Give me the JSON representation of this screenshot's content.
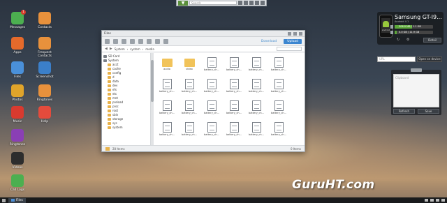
{
  "toolbar": {
    "search_placeholder": "Search"
  },
  "desktop_icons": [
    {
      "label": "Messages",
      "color": "#4caf50",
      "badge": "1"
    },
    {
      "label": "Contacts",
      "color": "#e8913c"
    },
    {
      "label": "Apps",
      "color": "#e56a2b"
    },
    {
      "label": "Frequent Contacts",
      "color": "#e8913c"
    },
    {
      "label": "Files",
      "color": "#4a90d9"
    },
    {
      "label": "Screenshot",
      "color": "#3b7fc9"
    },
    {
      "label": "Photos",
      "color": "#e0a42a"
    },
    {
      "label": "Ringtones",
      "color": "#e8913c"
    },
    {
      "label": "Music",
      "color": "#d83a2f"
    },
    {
      "label": "Help",
      "color": "#e44b3c"
    },
    {
      "label": "Ringtones",
      "color": "#8a3fb5"
    },
    {
      "label": "Videos",
      "color": "#2d2d2d"
    },
    {
      "label": "Call Logs",
      "color": "#4caf50"
    }
  ],
  "files_window": {
    "title": "Files",
    "download_label": "Download",
    "upload_label": "Upload",
    "path": [
      "System",
      "system",
      "media"
    ],
    "tree": [
      {
        "label": "SD Card",
        "root": true
      },
      {
        "label": "System",
        "root": true
      },
      {
        "label": "acct"
      },
      {
        "label": "cache"
      },
      {
        "label": "config"
      },
      {
        "label": "d"
      },
      {
        "label": "data"
      },
      {
        "label": "dev"
      },
      {
        "label": "efs"
      },
      {
        "label": "etc"
      },
      {
        "label": "mnt"
      },
      {
        "label": "preload"
      },
      {
        "label": "proc"
      },
      {
        "label": "root"
      },
      {
        "label": "sbin"
      },
      {
        "label": "storage"
      },
      {
        "label": "sys"
      },
      {
        "label": "system"
      }
    ],
    "items": [
      {
        "name": "audio",
        "type": "folder"
      },
      {
        "name": "video",
        "type": "folder"
      },
      {
        "name": "battery_ch...",
        "type": "file"
      },
      {
        "name": "battery_ch...",
        "type": "file"
      },
      {
        "name": "battery_ch...",
        "type": "file"
      },
      {
        "name": "battery_ch...",
        "type": "file"
      },
      {
        "name": "battery_ch...",
        "type": "file"
      },
      {
        "name": "battery_ch...",
        "type": "file"
      },
      {
        "name": "battery_ch...",
        "type": "file"
      },
      {
        "name": "battery_ch...",
        "type": "file"
      },
      {
        "name": "battery_ch...",
        "type": "file"
      },
      {
        "name": "battery_ch...",
        "type": "file"
      },
      {
        "name": "battery_ch...",
        "type": "file"
      },
      {
        "name": "battery_ch...",
        "type": "file"
      },
      {
        "name": "battery_ch...",
        "type": "file"
      },
      {
        "name": "battery_ch...",
        "type": "file"
      },
      {
        "name": "battery_ch...",
        "type": "file"
      },
      {
        "name": "battery_ch...",
        "type": "file"
      },
      {
        "name": "battery_ch...",
        "type": "file"
      },
      {
        "name": "battery_ch...",
        "type": "file"
      },
      {
        "name": "battery_ch...",
        "type": "file"
      },
      {
        "name": "battery_ch...",
        "type": "file"
      },
      {
        "name": "battery_ch...",
        "type": "file"
      },
      {
        "name": "battery_ch...",
        "type": "file"
      }
    ],
    "status": "28 Items",
    "selection": "0 Items"
  },
  "device": {
    "name": "Samsung GT-I9...",
    "model": "Android 4.1",
    "storage_1": "506.0 MB / 1.1 GB",
    "storage_1_fill": 0.45,
    "storage_2": "0.0 GB / 11.9 GB",
    "storage_2_fill": 0.05,
    "detail_label": "Detail"
  },
  "url_box": {
    "placeholder": "URL",
    "button": "Open on device"
  },
  "clipboard": {
    "placeholder": "Clipboard",
    "refresh_label": "Refresh",
    "save_label": "Save"
  },
  "watermark": "GuruHT.com",
  "taskbar": {
    "files_label": "Files"
  }
}
